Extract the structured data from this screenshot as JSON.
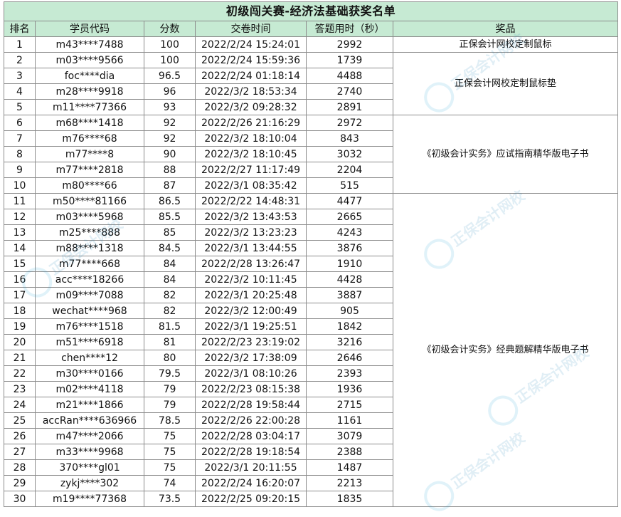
{
  "title": "初级闯关赛-经济法基础获奖名单",
  "headers": {
    "rank": "排名",
    "code": "学员代码",
    "score": "分数",
    "time": "交卷时间",
    "duration": "答题用时（秒）",
    "prize": "奖品"
  },
  "rows": [
    {
      "rank": "1",
      "code": "m43****7488",
      "score": "100",
      "time": "2022/2/24 15:24:01",
      "duration": "2992"
    },
    {
      "rank": "2",
      "code": "m03****9566",
      "score": "100",
      "time": "2022/2/24 15:59:36",
      "duration": "1739"
    },
    {
      "rank": "3",
      "code": "foc****dia",
      "score": "96.5",
      "time": "2022/2/24 01:18:14",
      "duration": "4488"
    },
    {
      "rank": "4",
      "code": "m28****9918",
      "score": "96",
      "time": "2022/3/2 18:53:34",
      "duration": "2740"
    },
    {
      "rank": "5",
      "code": "m11****77366",
      "score": "93",
      "time": "2022/3/2 09:28:32",
      "duration": "2891"
    },
    {
      "rank": "6",
      "code": "m68****1418",
      "score": "92",
      "time": "2022/2/26 21:16:29",
      "duration": "2972"
    },
    {
      "rank": "7",
      "code": "m76****68",
      "score": "92",
      "time": "2022/3/2 18:10:04",
      "duration": "843"
    },
    {
      "rank": "8",
      "code": "m77****8",
      "score": "90",
      "time": "2022/3/2 18:10:45",
      "duration": "3032"
    },
    {
      "rank": "9",
      "code": "m77****2818",
      "score": "88",
      "time": "2022/2/27 11:17:49",
      "duration": "2204"
    },
    {
      "rank": "10",
      "code": "m80****66",
      "score": "87",
      "time": "2022/3/1 08:35:42",
      "duration": "515"
    },
    {
      "rank": "11",
      "code": "m50****81166",
      "score": "86.5",
      "time": "2022/2/22 14:48:31",
      "duration": "4477"
    },
    {
      "rank": "12",
      "code": "m03****5968",
      "score": "85.5",
      "time": "2022/3/2 13:43:53",
      "duration": "2665"
    },
    {
      "rank": "13",
      "code": "m25****888",
      "score": "85",
      "time": "2022/3/2 13:23:23",
      "duration": "4243"
    },
    {
      "rank": "14",
      "code": "m88****1318",
      "score": "84.5",
      "time": "2022/3/1 13:44:55",
      "duration": "3876"
    },
    {
      "rank": "15",
      "code": "m77****668",
      "score": "84",
      "time": "2022/2/28 13:26:47",
      "duration": "1910"
    },
    {
      "rank": "16",
      "code": "acc****18266",
      "score": "84",
      "time": "2022/3/2 10:11:45",
      "duration": "4428"
    },
    {
      "rank": "17",
      "code": "m09****7088",
      "score": "82",
      "time": "2022/3/1 20:25:48",
      "duration": "3887"
    },
    {
      "rank": "18",
      "code": "wechat****968",
      "score": "82",
      "time": "2022/3/2 12:00:49",
      "duration": "905"
    },
    {
      "rank": "19",
      "code": "m76****1518",
      "score": "81.5",
      "time": "2022/3/1 19:25:51",
      "duration": "1842"
    },
    {
      "rank": "20",
      "code": "m51****6918",
      "score": "81",
      "time": "2022/2/23 23:19:02",
      "duration": "3216"
    },
    {
      "rank": "21",
      "code": "chen****12",
      "score": "80",
      "time": "2022/3/2 17:38:09",
      "duration": "2646"
    },
    {
      "rank": "22",
      "code": "m30****0166",
      "score": "79.5",
      "time": "2022/3/1 08:10:26",
      "duration": "2393"
    },
    {
      "rank": "23",
      "code": "m02****4118",
      "score": "79",
      "time": "2022/2/23 08:15:38",
      "duration": "1936"
    },
    {
      "rank": "24",
      "code": "m21****1866",
      "score": "79",
      "time": "2022/2/28 19:58:44",
      "duration": "2715"
    },
    {
      "rank": "25",
      "code": "accRan****636966",
      "score": "78.5",
      "time": "2022/2/26 22:00:28",
      "duration": "1161"
    },
    {
      "rank": "26",
      "code": "m47****2066",
      "score": "75",
      "time": "2022/2/28 03:04:17",
      "duration": "3079"
    },
    {
      "rank": "27",
      "code": "m33****9968",
      "score": "75",
      "time": "2022/2/28 19:18:54",
      "duration": "2388"
    },
    {
      "rank": "28",
      "code": "370****gl01",
      "score": "75",
      "time": "2022/3/1 20:11:55",
      "duration": "1487"
    },
    {
      "rank": "29",
      "code": "zykj****302",
      "score": "74",
      "time": "2022/2/24 16:20:07",
      "duration": "2213"
    },
    {
      "rank": "30",
      "code": "m19****77368",
      "score": "73.5",
      "time": "2022/2/25 09:20:15",
      "duration": "1835"
    }
  ],
  "prizes": [
    {
      "label": "正保会计网校定制鼠标",
      "from_rank": 1,
      "span": 1
    },
    {
      "label": "正保会计网校定制鼠标垫",
      "from_rank": 2,
      "span": 4
    },
    {
      "label": "《初级会计实务》应试指南精华版电子书",
      "from_rank": 6,
      "span": 5
    },
    {
      "label": "《初级会计实务》经典题解精华版电子书",
      "from_rank": 11,
      "span": 20
    }
  ],
  "watermark": {
    "text": "正保会计网校",
    "url_text": "www.chinaacc.com"
  },
  "colors": {
    "header_bg": "#c6ead3",
    "border": "#8c8c8c",
    "watermark": "#1a9fd8"
  }
}
